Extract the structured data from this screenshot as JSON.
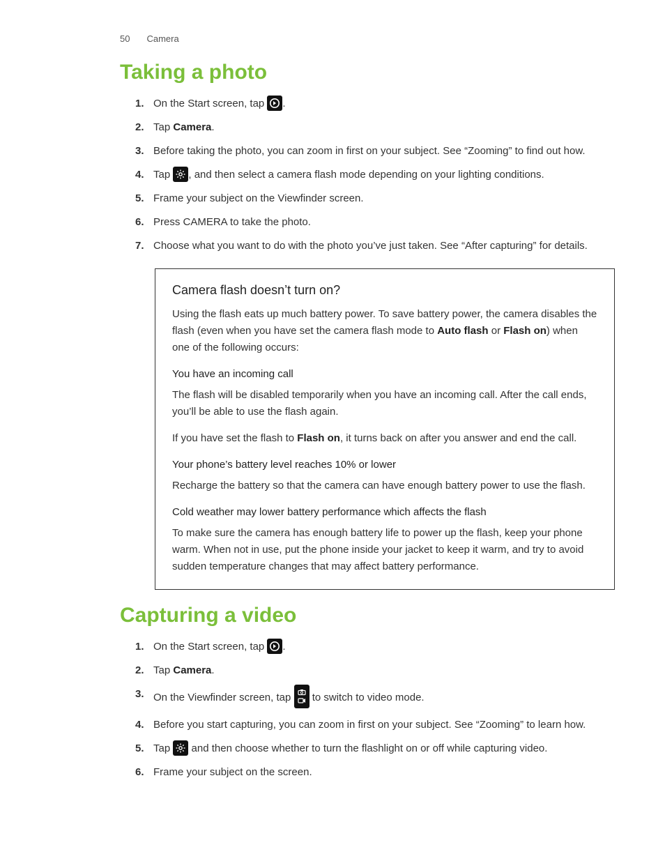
{
  "header": {
    "page_number": "50",
    "section": "Camera"
  },
  "h1_photo": "Taking a photo",
  "photo_steps": {
    "s1a": "On the Start screen, tap ",
    "s1b": ".",
    "s2a": "Tap ",
    "s2b_bold": "Camera",
    "s2c": ".",
    "s3": "Before taking the photo, you can zoom in first on your subject. See “Zooming” to find out how.",
    "s4a": "Tap ",
    "s4b": ", and then select a camera flash mode depending on your lighting conditions.",
    "s5": "Frame your subject on the Viewfinder screen.",
    "s6": "Press CAMERA to take the photo.",
    "s7": "Choose what you want to do with the photo you’ve just taken. See “After capturing” for details."
  },
  "info": {
    "title": "Camera flash doesn’t turn on?",
    "intro_a": "Using the flash eats up much battery power. To save battery power, the camera disables the flash (even when you have set the camera flash mode to ",
    "intro_b_bold": "Auto flash",
    "intro_c": " or ",
    "intro_d_bold": "Flash on",
    "intro_e": ") when one of the following occurs:",
    "sub1": "You have an incoming call",
    "p1": "The flash will be disabled temporarily when you have an incoming call. After the call ends, you’ll be able to use the flash again.",
    "p2a": "If you have set the flash to ",
    "p2b_bold": "Flash on",
    "p2c": ", it turns back on after you answer and end the call.",
    "sub2": "Your phone’s battery level reaches 10% or lower",
    "p3": "Recharge the battery so that the camera can have enough battery power to use the flash.",
    "sub3": "Cold weather may lower battery performance which affects the flash",
    "p4": "To make sure the camera has enough battery life to power up the flash, keep your phone warm. When not in use, put the phone inside your jacket to keep it warm, and try to avoid sudden temperature changes that may affect battery performance."
  },
  "h1_video": "Capturing a video",
  "video_steps": {
    "s1a": "On the Start screen, tap ",
    "s1b": ".",
    "s2a": "Tap ",
    "s2b_bold": "Camera",
    "s2c": ".",
    "s3a": "On the Viewfinder screen, tap ",
    "s3b": " to switch to video mode.",
    "s4": "Before you start capturing, you can zoom in first on your subject. See “Zooming” to learn how.",
    "s5a": "Tap ",
    "s5b": " and then choose whether to turn the flashlight on or off while capturing video.",
    "s6": "Frame your subject on the screen."
  }
}
